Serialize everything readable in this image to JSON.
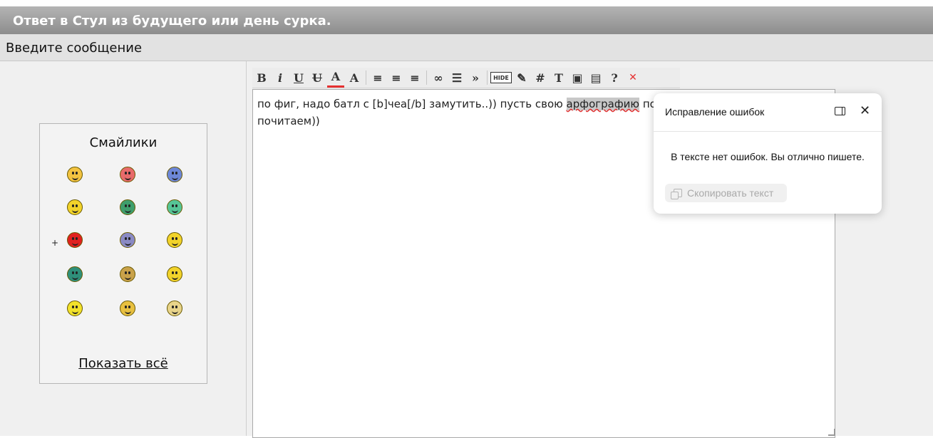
{
  "page": {
    "title": "Ответ в Стул из будущего или день сурка.",
    "subtitle": "Введите сообщение"
  },
  "smilies": {
    "title": "Смайлики",
    "show_all": "Показать всё",
    "plus": "+",
    "items": [
      {
        "icon": "cool-smiley-icon",
        "color": "#f3c340"
      },
      {
        "icon": "in-love-smiley-icon",
        "color": "#e86b6b"
      },
      {
        "icon": "crying-smiley-icon",
        "color": "#6d87d8"
      },
      {
        "icon": "thinking-smiley-icon",
        "color": "#f2d32a"
      },
      {
        "icon": "shooting-smiley-icon",
        "color": "#3e9e6c"
      },
      {
        "icon": "green-smiley-icon",
        "color": "#56c596"
      },
      {
        "icon": "gun-smiley-icon",
        "color": "#e02020"
      },
      {
        "icon": "dancing-smiley-icon",
        "color": "#8a8ac4"
      },
      {
        "icon": "victory-smiley-icon",
        "color": "#f2d32a"
      },
      {
        "icon": "pacman-smiley-icon",
        "color": "#2e8f7a"
      },
      {
        "icon": "applause-smiley-icon",
        "color": "#c9a24a"
      },
      {
        "icon": "cheerleader-smiley-icon",
        "color": "#f2d32a"
      },
      {
        "icon": "bomb-smiley-icon",
        "color": "#f2e22a"
      },
      {
        "icon": "laughing-smiley-icon",
        "color": "#e8c040"
      },
      {
        "icon": "star-smiley-icon",
        "color": "#e8d48a"
      }
    ]
  },
  "toolbar": {
    "buttons": [
      {
        "name": "bold-button",
        "glyph": "B"
      },
      {
        "name": "italic-button",
        "glyph": "i"
      },
      {
        "name": "underline-button",
        "glyph": "U"
      },
      {
        "name": "strikethrough-button",
        "glyph": "U"
      },
      {
        "name": "font-color-button",
        "glyph": "A"
      },
      {
        "name": "font-size-button",
        "glyph": "A"
      },
      {
        "name": "align-left-button",
        "glyph": "≡"
      },
      {
        "name": "align-center-button",
        "glyph": "≡"
      },
      {
        "name": "align-right-button",
        "glyph": "≡"
      },
      {
        "name": "link-button",
        "glyph": "∞"
      },
      {
        "name": "list-button",
        "glyph": "☰"
      },
      {
        "name": "quote-button",
        "glyph": "»"
      },
      {
        "name": "hide-button",
        "glyph": "HIDE"
      },
      {
        "name": "edit-button",
        "glyph": "✎"
      },
      {
        "name": "code-button",
        "glyph": "#"
      },
      {
        "name": "text-button",
        "glyph": "T"
      },
      {
        "name": "image-button",
        "glyph": "▣"
      },
      {
        "name": "video-button",
        "glyph": "▤"
      },
      {
        "name": "help-button",
        "glyph": "?"
      },
      {
        "name": "clear-button",
        "glyph": "✕"
      }
    ]
  },
  "editor": {
    "text_before": "по фиг, надо батл с [b]чеа[/b] замутить..)) пусть свою ",
    "highlighted_word": "арфографию",
    "text_after": " по",
    "line2": "почитаем))"
  },
  "popup": {
    "title": "Исправление ошибок",
    "message": "В тексте нет ошибок. Вы отлично пишете.",
    "copy_label": "Скопировать текст",
    "close_glyph": "✕"
  },
  "colors": {
    "title_bar": "#9f9f9f",
    "background": "#f0f0f0",
    "accent_red": "#e53030"
  }
}
